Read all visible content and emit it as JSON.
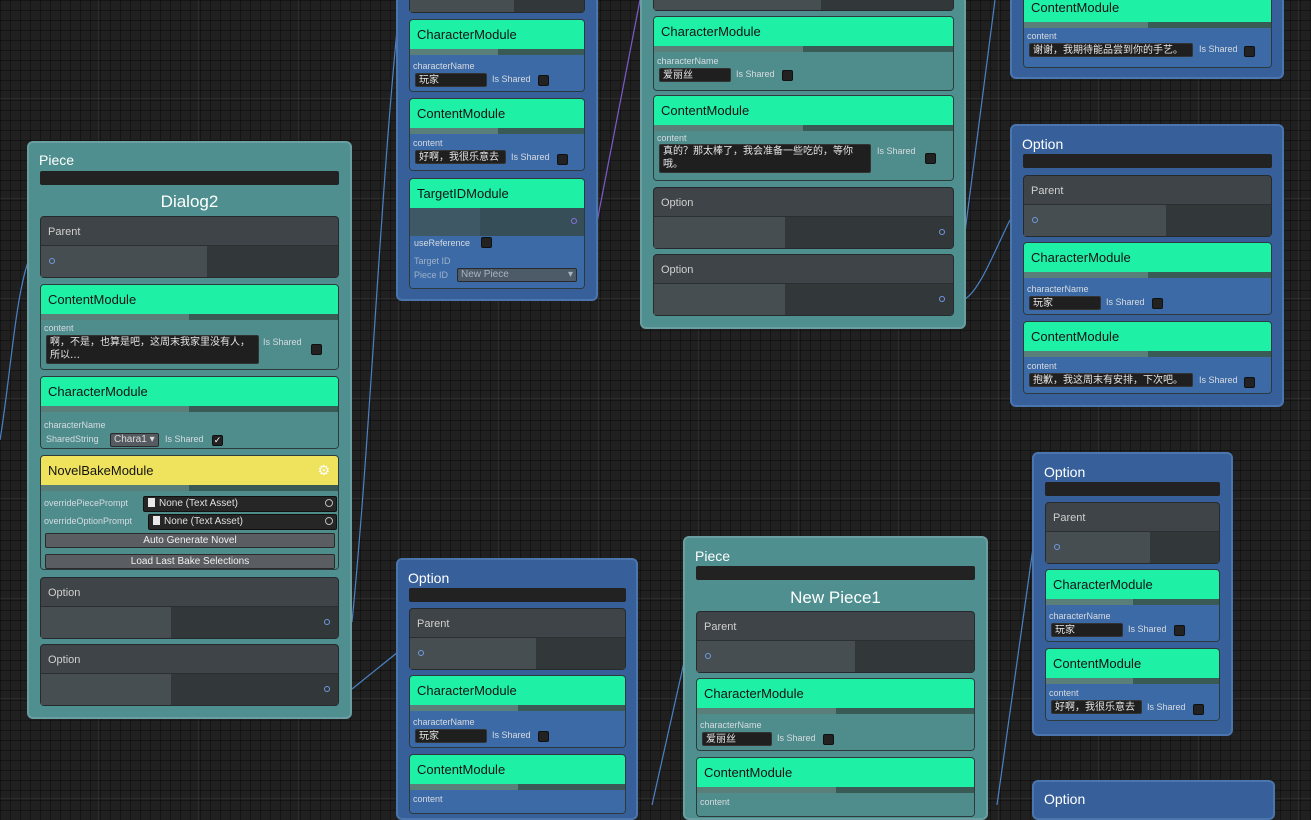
{
  "labels": {
    "piece": "Piece",
    "option": "Option",
    "parent": "Parent",
    "character_module": "CharacterModule",
    "content_module": "ContentModule",
    "target_id_module": "TargetIDModule",
    "novel_bake_module": "NovelBakeModule",
    "character_name": "characterName",
    "content": "content",
    "is_shared": "Is Shared",
    "use_reference": "useReference",
    "target_id": "Target ID",
    "piece_id": "Piece ID",
    "shared_string": "SharedString"
  },
  "dialog2": {
    "name": "Dialog2",
    "content_text": "啊，不是，也算是吧，这周末我家里没有人，所以…",
    "chara_select": "Chara1",
    "override_piece_prompt": "overridePiecePrompt",
    "override_option_prompt": "overrideOptionPrompt",
    "none_text_asset": "None (Text Asset)",
    "auto_generate_button": "Auto Generate Novel",
    "load_last_button": "Load Last Bake Selections"
  },
  "node_a": {
    "character_value": "玩家",
    "content_value": "好啊，我很乐意去",
    "piece_id_value": "New Piece"
  },
  "node_b": {
    "character_value": "爱丽丝",
    "content_value": "真的？那太棒了，我会准备一些吃的，等你哦。"
  },
  "node_c": {
    "content_value": "谢谢，我期待能品尝到你的手艺。"
  },
  "node_d": {
    "character_value": "玩家",
    "content_value": "抱歉，我这周末有安排，下次吧。"
  },
  "node_e": {
    "character_value": "玩家",
    "content_value": "好啊，我很乐意去"
  },
  "node_f": {
    "character_value": "玩家"
  },
  "new_piece1": {
    "name": "New Piece1",
    "character_value": "爱丽丝"
  },
  "colors": {
    "piece_node": "#4f8f8f",
    "option_node": "#37609a",
    "module_header": "#1ef0a6",
    "novel_bake_header": "#efe25c",
    "grid_background": "#202020"
  }
}
